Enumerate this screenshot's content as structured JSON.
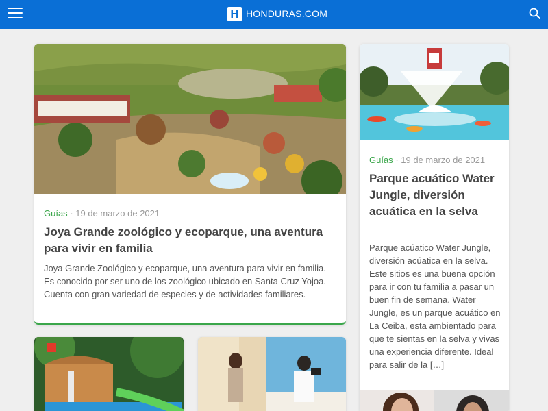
{
  "header": {
    "logo_letter": "H",
    "site_name": "HONDURAS.COM",
    "menu_icon": "hamburger-menu-icon",
    "search_icon": "magnifier-search-icon",
    "bar_color": "#0a6fd6"
  },
  "articles": [
    {
      "category": "Guías",
      "date": "· 19 de marzo de 2021",
      "title": "Joya Grande zoológico y ecoparque, una aventura para vivir en familia",
      "excerpt": "Joya Grande Zoológico y ecoparque, una aventura para vivir en familia. Es conocido por ser uno de los zoológico ubicado en Santa Cruz Yojoa. Cuenta con gran variedad de especies y de actividades familiares."
    },
    {
      "category": "Guías",
      "date": "· 19 de marzo de 2021",
      "title": "Parque acuático Water Jungle, diversión acuática en la selva",
      "excerpt": "Parque acúatico Water Jungle, diversión acúatica en la selva. Este sitios es una buena opción para ir con tu familia a pasar un buen fin de semana. Water Jungle, es un parque acuático en La Ceiba, esta ambientado para que te sientas en la selva y vivas una experiencia diferente. Ideal para salir de la […]"
    }
  ],
  "colors": {
    "category_green": "#3aa64a",
    "title_text": "#444444"
  }
}
